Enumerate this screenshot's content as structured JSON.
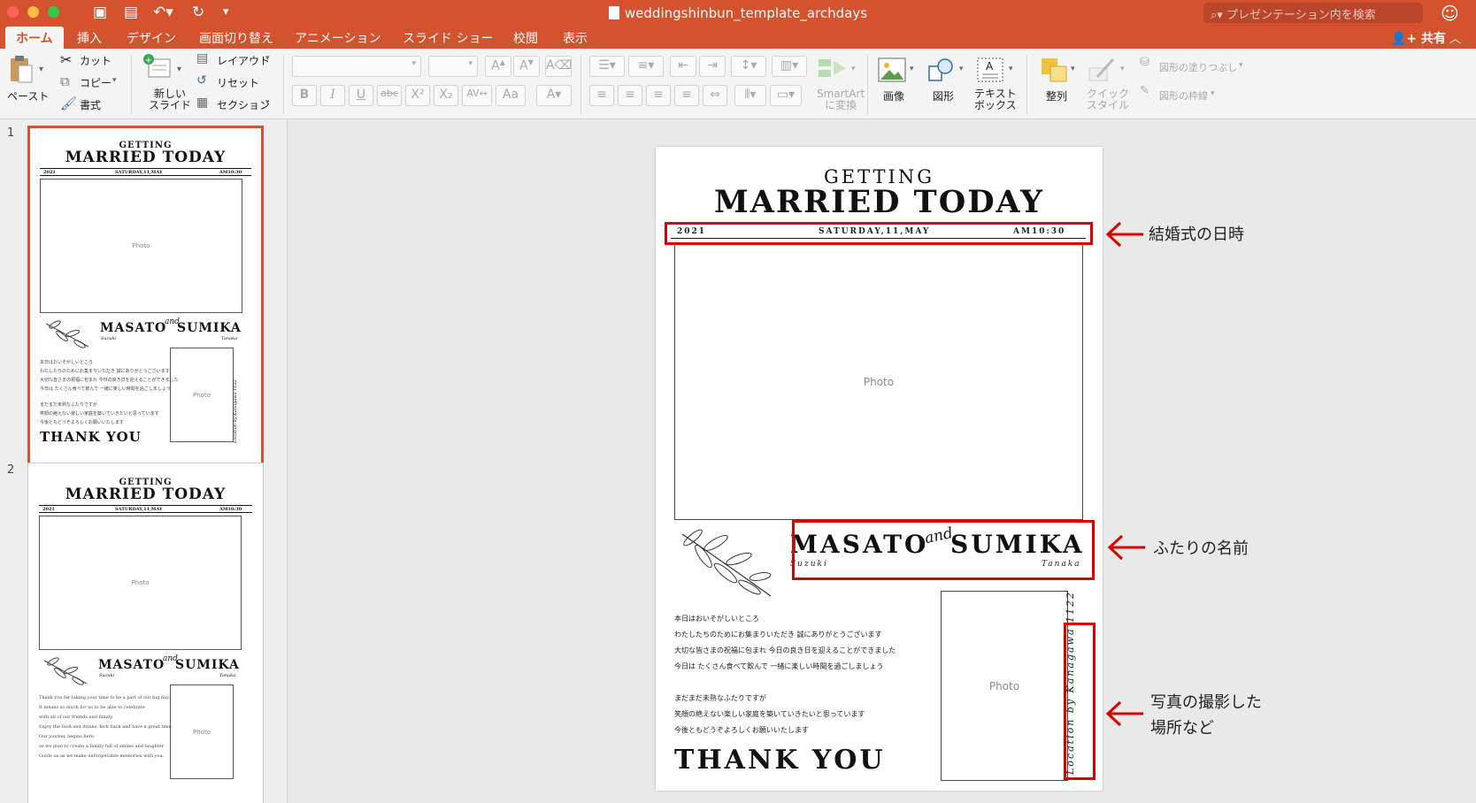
{
  "app": {
    "document_title": "weddingshinbun_template_archdays",
    "search_placeholder": "プレゼンテーション内を検索",
    "accent_color": "#d4522d",
    "annotation_color": "#d90000"
  },
  "tabs": [
    "ホーム",
    "挿入",
    "デザイン",
    "画面切り替え",
    "アニメーション",
    "スライド ショー",
    "校閲",
    "表示"
  ],
  "share_label": "共有",
  "ribbon": {
    "paste": "ペースト",
    "cut": "カット",
    "copy": "コピー",
    "format_painter": "書式",
    "new_slide": [
      "新しい",
      "スライド"
    ],
    "layout": "レイアウト",
    "reset": "リセット",
    "section": "セクション",
    "smartart": [
      "SmartArt",
      "に変換"
    ],
    "picture": "画像",
    "shapes": "図形",
    "textbox": [
      "テキスト",
      "ボックス"
    ],
    "arrange": "整列",
    "quick_styles": [
      "クイック",
      "スタイル"
    ],
    "shape_fill": "図形の塗りつぶし",
    "shape_outline": "図形の枠線"
  },
  "slide_numbers": [
    "1",
    "2"
  ],
  "slide": {
    "getting": "GETTING",
    "married_today": "MARRIED TODAY",
    "year": "2021",
    "date": "SATURDAY,11,MAY",
    "time": "AM10:30",
    "photo_label": "Photo",
    "groom": "MASATO",
    "and": "and",
    "bride": "SUMIKA",
    "groom_surname": "Suzuki",
    "bride_surname": "Tanaka",
    "message_lines": [
      "本日はおいそがしいところ",
      "わたしたちのためにお集まりいただき 誠にありがとうございます",
      "大切な皆さまの祝福に包まれ 今日の良き日を迎えることができました",
      "今日は たくさん食べて飲んで 一緒に楽しい時間を過ごしましょう",
      "",
      "まだまだ未熟なふたりですが",
      "笑顔の絶えない楽しい家庭を築いていきたいと思っています",
      "今後ともどうぞよろしくお願いいたします"
    ],
    "thank_you": "THANK YOU",
    "location": "Location by Kanagawa 1122"
  },
  "slide2_message_lines": [
    "Thank you for taking your time to be a part of our big day.",
    "It means so much for us to be able to celebrate",
    "with all of our friends and family.",
    "Enjoy the food and drinks, kick back and have a great time.",
    "Our journey begins here,",
    "as we plan to create a family full of smiles and laughter.",
    "Guide us as we make unforgettable memories with you."
  ],
  "annotations": {
    "datetime": "結婚式の日時",
    "names": "ふたりの名前",
    "location_line1": "写真の撮影した",
    "location_line2": "場所など"
  }
}
